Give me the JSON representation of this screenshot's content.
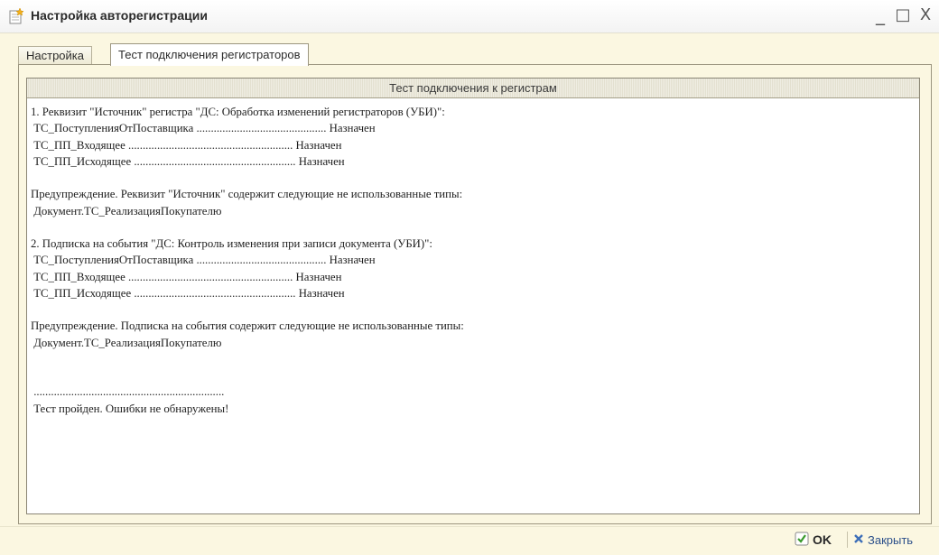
{
  "window": {
    "title": "Настройка авторегистрации",
    "controls": {
      "minimize": "_",
      "maximize": "□",
      "close": "X"
    }
  },
  "tabs": [
    {
      "label": "Настройка",
      "active": false
    },
    {
      "label": "Тест подключения регистраторов",
      "active": true
    }
  ],
  "panel": {
    "header": "Тест подключения к регистрам",
    "lines": [
      "1. Реквизит \"Источник\" регистра \"ДС: Обработка изменений регистраторов (УБИ)\":",
      " ТС_ПоступленияОтПоставщика ............................................. Назначен",
      " ТС_ПП_Входящее ......................................................... Назначен",
      " ТС_ПП_Исходящее ........................................................ Назначен",
      "",
      "Предупреждение. Реквизит \"Источник\" содержит следующие не использованные типы:",
      " Документ.ТС_РеализацияПокупателю",
      "",
      "2. Подписка на события \"ДС: Контроль изменения при записи документа (УБИ)\":",
      " ТС_ПоступленияОтПоставщика ............................................. Назначен",
      " ТС_ПП_Входящее ......................................................... Назначен",
      " ТС_ПП_Исходящее ........................................................ Назначен",
      "",
      "Предупреждение. Подписка на события содержит следующие не использованные типы:",
      " Документ.ТС_РеализацияПокупателю",
      "",
      "",
      " ..................................................................",
      " Тест пройден. Ошибки не обнаружены!"
    ]
  },
  "buttons": {
    "ok_label": "OK",
    "close_label": "Закрыть"
  },
  "colors": {
    "window_bg": "#fbf7e1",
    "ok_check": "#3a9a2e",
    "close_x": "#3d6fb8"
  },
  "icons": {
    "app": "document-star-icon",
    "ok": "checkmark-icon",
    "close": "close-x-icon"
  }
}
